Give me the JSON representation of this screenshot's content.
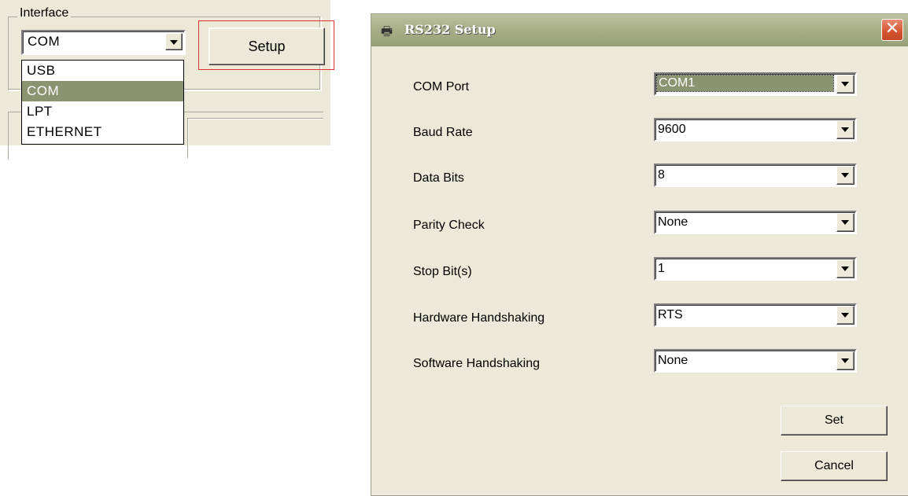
{
  "interface_panel": {
    "group_label": "Interface",
    "combo_value": "COM",
    "dropdown_items": [
      "USB",
      "COM",
      "LPT",
      "ETHERNET"
    ],
    "selected_item": "COM",
    "setup_label": "Setup"
  },
  "dialog": {
    "title": "RS232 Setup",
    "close_symbol": "✕",
    "fields": [
      {
        "label": "COM Port",
        "value": "COM1"
      },
      {
        "label": "Baud Rate",
        "value": "9600"
      },
      {
        "label": "Data Bits",
        "value": "8"
      },
      {
        "label": "Parity Check",
        "value": "None"
      },
      {
        "label": "Stop Bit(s)",
        "value": "1"
      },
      {
        "label": "Hardware Handshaking",
        "value": "RTS"
      },
      {
        "label": "Software Handshaking",
        "value": "None"
      }
    ],
    "set_label": "Set",
    "cancel_label": "Cancel"
  },
  "colors": {
    "highlight": "#e03030",
    "selection": "#8a9470",
    "titlebar": "#a9b08a"
  }
}
